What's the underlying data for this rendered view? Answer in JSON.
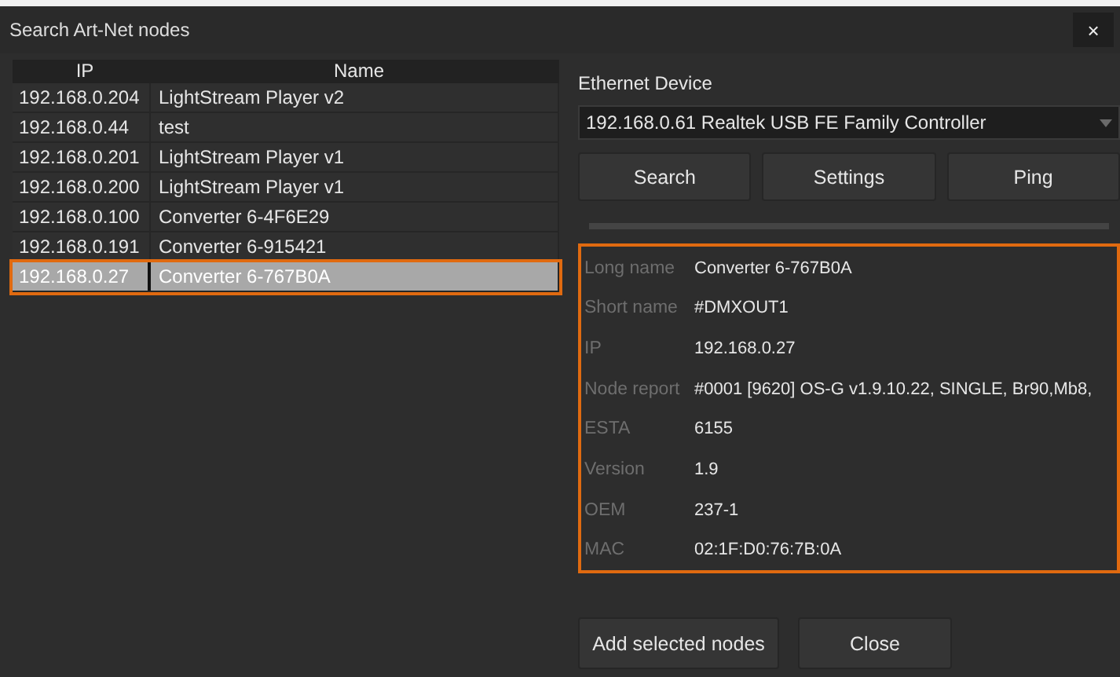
{
  "window": {
    "title": "Search Art-Net nodes",
    "close": "×"
  },
  "table": {
    "columns": [
      "IP",
      "Name"
    ],
    "rows": [
      {
        "ip": "192.168.0.204",
        "name": "LightStream Player v2",
        "selected": false
      },
      {
        "ip": "192.168.0.44",
        "name": "test",
        "selected": false
      },
      {
        "ip": "192.168.0.201",
        "name": "LightStream Player v1",
        "selected": false
      },
      {
        "ip": "192.168.0.200",
        "name": "LightStream Player v1",
        "selected": false
      },
      {
        "ip": "192.168.0.100",
        "name": "Converter 6-4F6E29",
        "selected": false
      },
      {
        "ip": "192.168.0.191",
        "name": "Converter 6-915421",
        "selected": false
      },
      {
        "ip": "192.168.0.27",
        "name": "Converter 6-767B0A",
        "selected": true
      }
    ]
  },
  "ethernet_device": {
    "label": "Ethernet Device",
    "value": "192.168.0.61 Realtek USB FE Family Controller"
  },
  "buttons": [
    "Search",
    "Settings",
    "Ping"
  ],
  "details": [
    {
      "label": "Long name",
      "value": "Converter 6-767B0A"
    },
    {
      "label": "Short name",
      "value": "#DMXOUT1"
    },
    {
      "label": "IP",
      "value": "192.168.0.27"
    },
    {
      "label": "Node report",
      "value": "#0001 [9620] OS-G v1.9.10.22, SINGLE, Br90,Mb8,"
    },
    {
      "label": "ESTA",
      "value": "6155"
    },
    {
      "label": "Version",
      "value": "1.9"
    },
    {
      "label": "OEM",
      "value": "237-1"
    },
    {
      "label": "MAC",
      "value": "02:1F:D0:76:7B:0A"
    }
  ],
  "footer_buttons": [
    "Add selected nodes",
    "Close"
  ]
}
